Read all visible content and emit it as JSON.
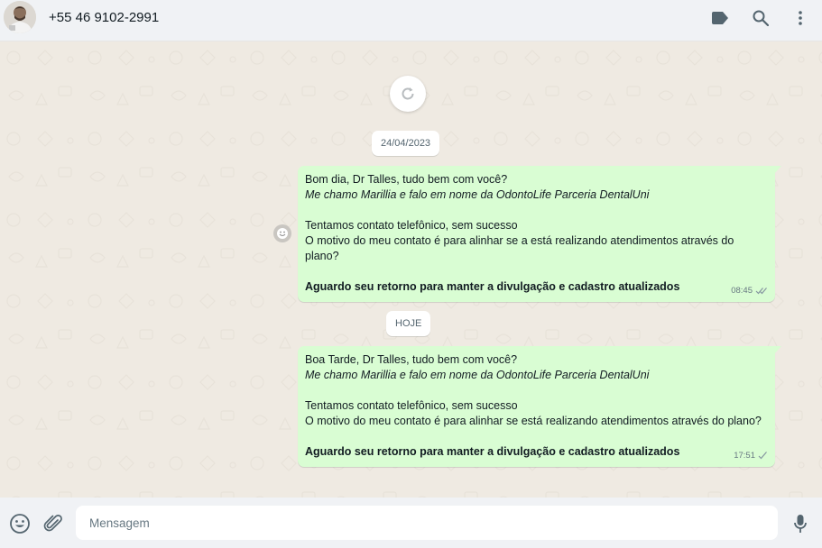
{
  "header": {
    "contact_name": "+55 46 9102-2991",
    "icons": [
      "label-icon",
      "search-icon",
      "menu-icon"
    ]
  },
  "chat": {
    "load_more_icon": "refresh-icon",
    "dates": [
      "24/04/2023",
      "HOJE"
    ],
    "messages": [
      {
        "line1": "Bom dia, Dr Talles, tudo bem com você?",
        "line2": "Me chamo Marillia e falo em nome da OdontoLife Parceria DentalUni",
        "line3": "Tentamos contato telefônico, sem sucesso",
        "line4": "O motivo do meu contato é para alinhar se a está realizando atendimentos através do plano?",
        "line5": "Aguardo seu retorno para manter a divulgação e cadastro atualizados",
        "time": "08:45",
        "status": "read"
      },
      {
        "line1": "Boa Tarde, Dr Talles, tudo bem com você?",
        "line2": "Me chamo Marillia e falo em nome da OdontoLife Parceria DentalUni",
        "line3": "Tentamos contato telefônico, sem sucesso",
        "line4": "O motivo do meu contato é para alinhar se está realizando atendimentos através do plano?",
        "line5": "Aguardo seu retorno para manter a divulgação e cadastro atualizados",
        "time": "17:51",
        "status": "sent"
      }
    ]
  },
  "footer": {
    "placeholder": "Mensagem",
    "icons": [
      "emoji-icon",
      "attach-icon",
      "mic-icon"
    ]
  },
  "colors": {
    "bubble": "#d9fdd3",
    "background": "#efeae2",
    "header": "#f0f2f5",
    "icon": "#54656f"
  }
}
